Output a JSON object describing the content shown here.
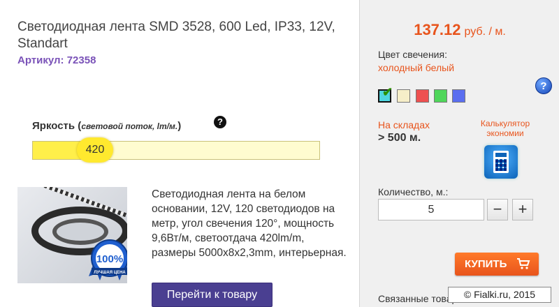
{
  "product": {
    "title": "Светодиодная лента SMD 3528, 600 Led, IP33, 12V, Standart",
    "sku_label": "Артикул:",
    "sku_value": "72358",
    "brightness_label": "Яркость",
    "brightness_hint": "световой поток, lm/м.",
    "brightness_value": "420",
    "brightness_fraction": 0.25,
    "description": "Светодиодная лента на белом основании, 12V, 120 светодиодов на метр, угол свечения 120°, мощность 9,6Вт/м, светоотдача 420lm/m, размеры 5000x8x2,3mm, интерьерная.",
    "go_button": "Перейти к товару",
    "badge_percent": "100%",
    "badge_text": "ЛУЧШАЯ ЦЕНА"
  },
  "purchase": {
    "price": "137.12",
    "price_unit": "руб. / м.",
    "color_label": "Цвет свечения:",
    "color_value": "холодный белый",
    "swatches": [
      "#4fd6e0",
      "#f6eec8",
      "#ee5050",
      "#4fd65a",
      "#5a6ef0"
    ],
    "stock_label": "На складах",
    "stock_value": "> 500 м.",
    "calc_label": "Калькулятор экономии",
    "qty_label": "Количество, м.:",
    "qty_value": "5",
    "minus": "−",
    "plus": "+",
    "buy_button": "КУПИТЬ",
    "related": "Связанные товары"
  },
  "watermark": "© Fialki.ru, 2015",
  "colors": {
    "accent": "#e8541c",
    "sku": "#7a52b8",
    "button": "#4a3f91"
  }
}
